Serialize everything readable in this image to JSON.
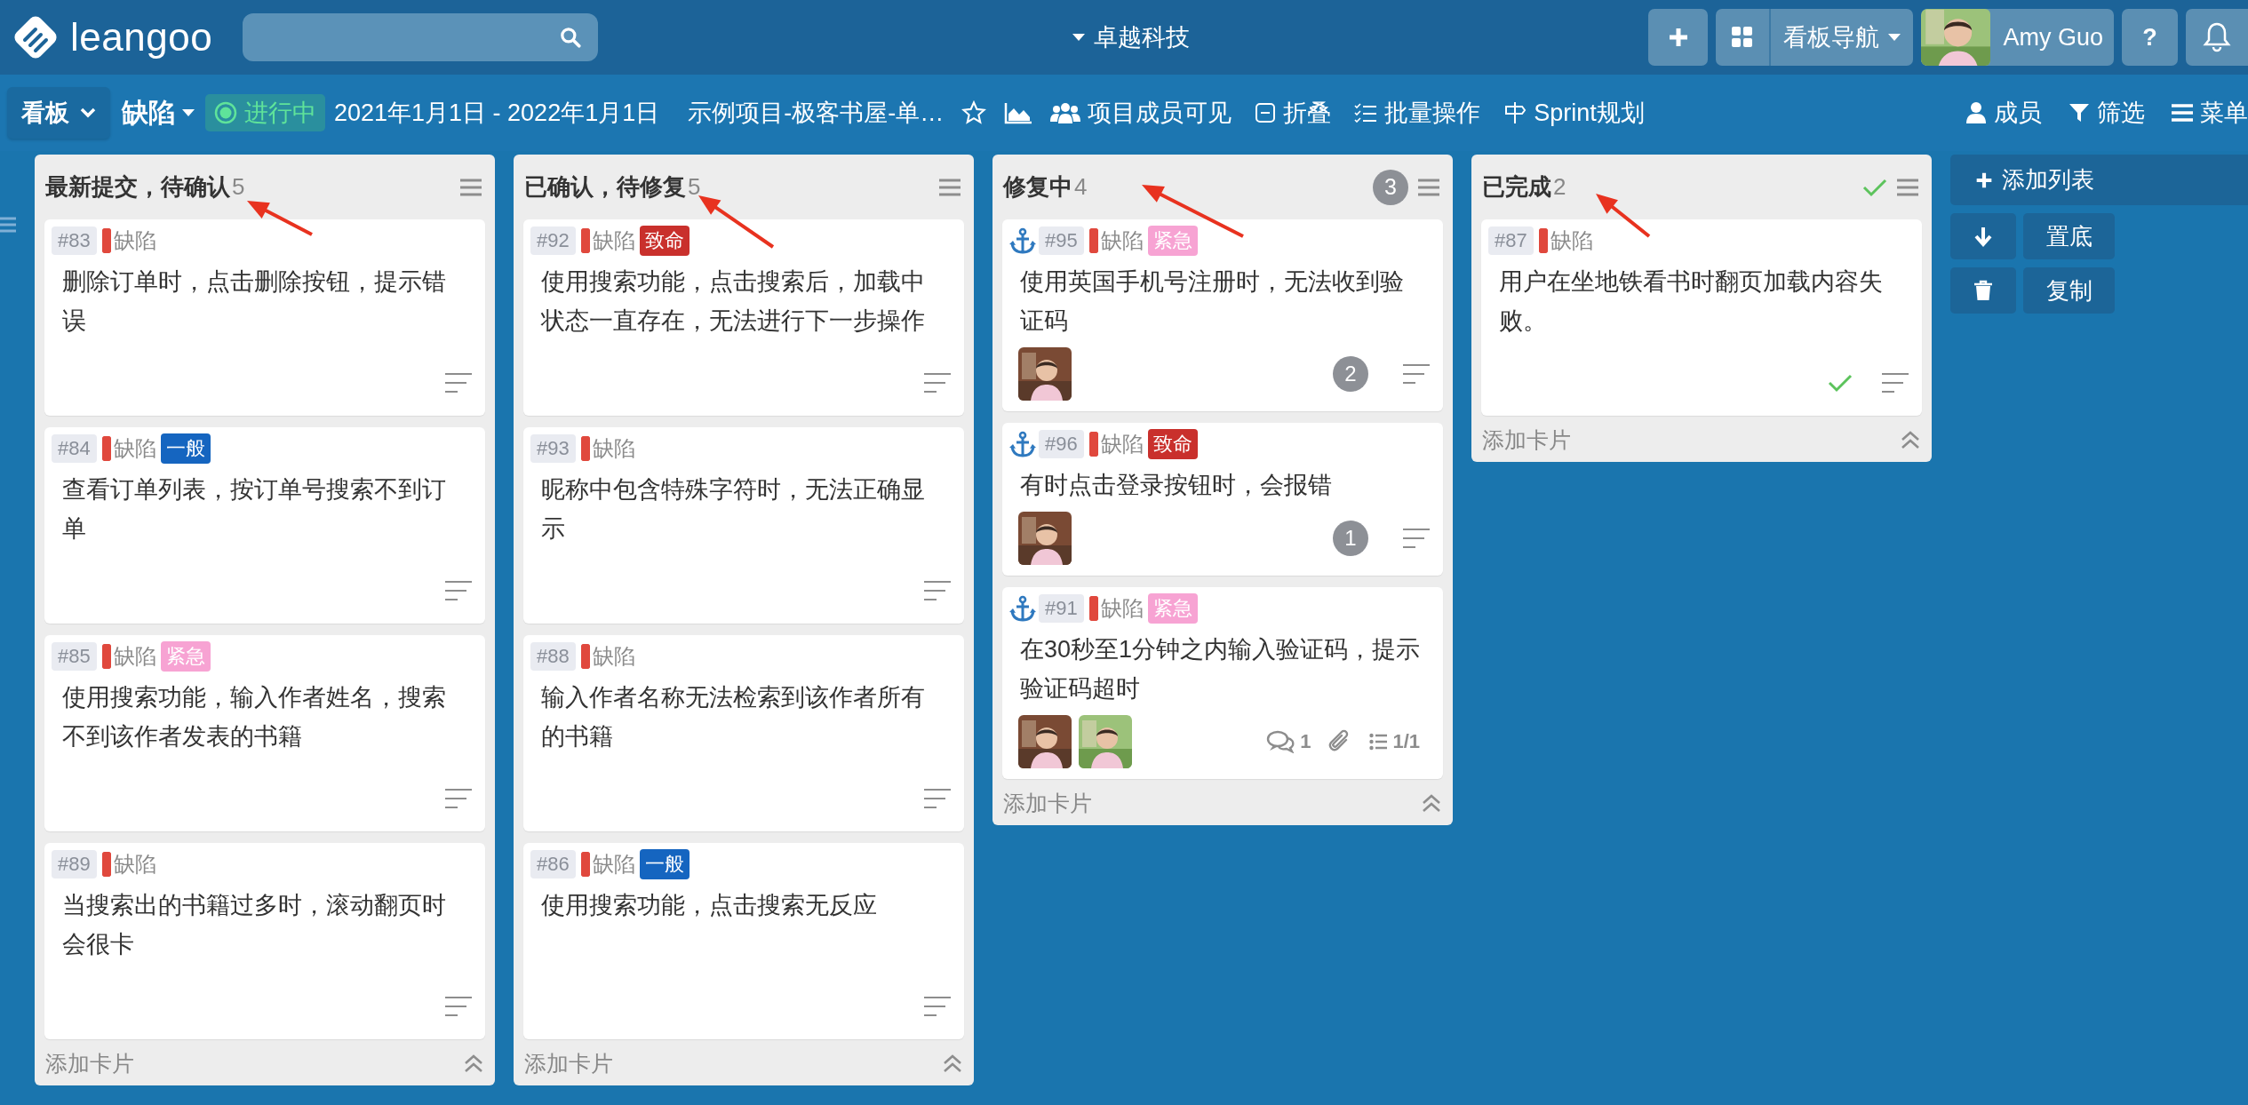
{
  "topbar": {
    "logo": "leangoo",
    "workspace": "卓越科技",
    "nav_label": "看板导航",
    "user": "Amy Guo",
    "help_label": "?"
  },
  "toolbar": {
    "view": "看板",
    "board": "缺陷",
    "status": "进行中",
    "dates": "2021年1月1日 - 2022年1月1日",
    "project": "示例项目-极客书屋-单…",
    "visibility": "项目成员可见",
    "actions": [
      {
        "kind": "collapse",
        "label": "折叠"
      },
      {
        "kind": "batch",
        "label": "批量操作"
      },
      {
        "kind": "sprint",
        "label": "Sprint规划"
      }
    ],
    "right_actions": [
      {
        "kind": "members",
        "label": "成员"
      },
      {
        "kind": "filter",
        "label": "筛选"
      },
      {
        "kind": "menu",
        "label": "菜单"
      }
    ]
  },
  "columns": [
    {
      "title": "最新提交，待确认",
      "count": "5",
      "arrow": true,
      "done": false,
      "add_card": "添加卡片",
      "cards": [
        {
          "id": "#83",
          "type": "缺陷",
          "anchor": false,
          "text": "删除订单时，点击删除按钮，提示错误"
        },
        {
          "id": "#84",
          "type": "缺陷",
          "anchor": false,
          "severity": {
            "label": "一般",
            "color": "#1565c0"
          },
          "text": "查看订单列表，按订单号搜索不到订单"
        },
        {
          "id": "#85",
          "type": "缺陷",
          "anchor": false,
          "severity": {
            "label": "紧急",
            "color": "#f7a3d3"
          },
          "text": "使用搜索功能，输入作者姓名，搜索不到该作者发表的书籍"
        },
        {
          "id": "#89",
          "type": "缺陷",
          "anchor": false,
          "text": "当搜索出的书籍过多时，滚动翻页时会很卡"
        }
      ]
    },
    {
      "title": "已确认，待修复",
      "count": "5",
      "arrow": true,
      "done": false,
      "add_card": "添加卡片",
      "cards": [
        {
          "id": "#92",
          "type": "缺陷",
          "anchor": false,
          "severity": {
            "label": "致命",
            "color": "#c9302c"
          },
          "text": "使用搜索功能，点击搜索后，加载中状态一直存在，无法进行下一步操作"
        },
        {
          "id": "#93",
          "type": "缺陷",
          "anchor": false,
          "text": "昵称中包含特殊字符时，无法正确显示"
        },
        {
          "id": "#88",
          "type": "缺陷",
          "anchor": false,
          "text": "输入作者名称无法检索到该作者所有的书籍"
        },
        {
          "id": "#86",
          "type": "缺陷",
          "anchor": false,
          "severity": {
            "label": "一般",
            "color": "#1565c0"
          },
          "text": "使用搜索功能，点击搜索无反应"
        }
      ]
    },
    {
      "title": "修复中",
      "count": "4",
      "badge": "3",
      "arrow": true,
      "done": false,
      "add_card": "添加卡片",
      "cards": [
        {
          "id": "#95",
          "type": "缺陷",
          "anchor": true,
          "severity": {
            "label": "紧急",
            "color": "#f7a3d3"
          },
          "text": "使用英国手机号注册时，无法收到验证码",
          "count": "2"
        },
        {
          "id": "#96",
          "type": "缺陷",
          "anchor": true,
          "severity": {
            "label": "致命",
            "color": "#c9302c"
          },
          "text": "有时点击登录按钮时，会报错",
          "count": "1"
        },
        {
          "id": "#91",
          "type": "缺陷",
          "anchor": true,
          "severity": {
            "label": "紧急",
            "color": "#f7a3d3"
          },
          "text": "在30秒至1分钟之内输入验证码，提示验证码超时",
          "comments": "1",
          "attachment": true,
          "checklist": "1/1"
        }
      ]
    },
    {
      "title": "已完成",
      "count": "2",
      "arrow": true,
      "done": true,
      "add_card": "添加卡片",
      "cards": [
        {
          "id": "#87",
          "type": "缺陷",
          "anchor": false,
          "done": true,
          "text": "用户在坐地铁看书时翻页加载内容失败。"
        }
      ]
    }
  ],
  "side_panel": {
    "add_list": "添加列表",
    "buttons": [
      {
        "kind": "bottom",
        "label": "置底"
      },
      {
        "kind": "copy",
        "label": "复制"
      }
    ]
  }
}
